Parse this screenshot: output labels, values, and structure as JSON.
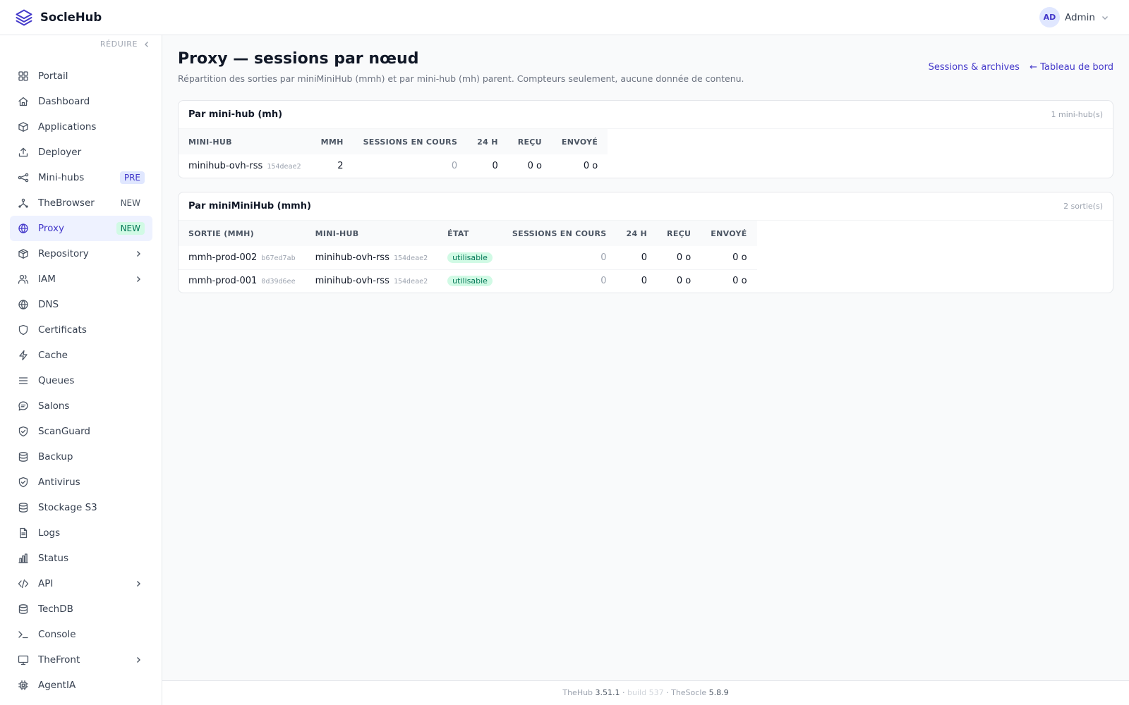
{
  "app": {
    "name": "SocleHub"
  },
  "user": {
    "initials": "AD",
    "name": "Admin"
  },
  "sidebar": {
    "collapse_label": "RÉDUIRE",
    "items": [
      {
        "label": "Portail",
        "icon": "grid-icon"
      },
      {
        "label": "Dashboard",
        "icon": "home-icon"
      },
      {
        "label": "Applications",
        "icon": "box-icon"
      },
      {
        "label": "Deployer",
        "icon": "upload-icon"
      },
      {
        "label": "Mini-hubs",
        "icon": "nodes-icon",
        "badge": "PRE"
      },
      {
        "label": "TheBrowser",
        "icon": "network-icon",
        "badge": "NEW"
      },
      {
        "label": "Proxy",
        "icon": "globe-icon",
        "badge": "NEW",
        "active": true
      },
      {
        "label": "Repository",
        "icon": "package-icon",
        "expandable": true
      },
      {
        "label": "IAM",
        "icon": "users-icon",
        "expandable": true
      },
      {
        "label": "DNS",
        "icon": "globe-icon"
      },
      {
        "label": "Certificats",
        "icon": "shield-icon"
      },
      {
        "label": "Cache",
        "icon": "bolt-icon"
      },
      {
        "label": "Queues",
        "icon": "list-icon"
      },
      {
        "label": "Salons",
        "icon": "chat-icon"
      },
      {
        "label": "ScanGuard",
        "icon": "shield-check-icon"
      },
      {
        "label": "Backup",
        "icon": "database-icon"
      },
      {
        "label": "Antivirus",
        "icon": "shield-check-icon"
      },
      {
        "label": "Stockage S3",
        "icon": "database-icon"
      },
      {
        "label": "Logs",
        "icon": "file-icon"
      },
      {
        "label": "Status",
        "icon": "bar-chart-icon"
      },
      {
        "label": "API",
        "icon": "code-icon",
        "expandable": true
      },
      {
        "label": "TechDB",
        "icon": "database-icon"
      },
      {
        "label": "Console",
        "icon": "terminal-icon"
      },
      {
        "label": "TheFront",
        "icon": "monitor-icon",
        "expandable": true
      },
      {
        "label": "AgentIA",
        "icon": "cpu-icon"
      }
    ]
  },
  "page": {
    "title": "Proxy — sessions par nœud",
    "subtitle": "Répartition des sorties par miniMiniHub (mmh) et par mini-hub (mh) parent. Compteurs seulement, aucune donnée de contenu.",
    "link_sessions": "Sessions & archives",
    "link_dashboard": "← Tableau de bord"
  },
  "card_mh": {
    "title": "Par mini-hub (mh)",
    "count": "1 mini-hub(s)",
    "columns": [
      "MINI-HUB",
      "MMH",
      "SESSIONS EN COURS",
      "24 H",
      "REÇU",
      "ENVOYÉ"
    ],
    "rows": [
      {
        "name": "minihub-ovh-rss",
        "hash": "154deae2",
        "mmh": "2",
        "sessions": "0",
        "h24": "0",
        "received": "0 o",
        "sent": "0 o"
      }
    ]
  },
  "card_mmh": {
    "title": "Par miniMiniHub (mmh)",
    "count": "2 sortie(s)",
    "columns": [
      "SORTIE (MMH)",
      "MINI-HUB",
      "ÉTAT",
      "SESSIONS EN COURS",
      "24 H",
      "REÇU",
      "ENVOYÉ"
    ],
    "rows": [
      {
        "name": "mmh-prod-002",
        "hash": "b67ed7ab",
        "minihub": "minihub-ovh-rss",
        "minihub_hash": "154deae2",
        "state": "utilisable",
        "sessions": "0",
        "h24": "0",
        "received": "0 o",
        "sent": "0 o"
      },
      {
        "name": "mmh-prod-001",
        "hash": "0d39d6ee",
        "minihub": "minihub-ovh-rss",
        "minihub_hash": "154deae2",
        "state": "utilisable",
        "sessions": "0",
        "h24": "0",
        "received": "0 o",
        "sent": "0 o"
      }
    ]
  },
  "footer": {
    "hub_label": "TheHub",
    "hub_version": "3.51.1",
    "sep1": "·",
    "build": "build 537",
    "sep2": "·",
    "socle_label": "TheSocle",
    "socle_version": "5.8.9"
  }
}
